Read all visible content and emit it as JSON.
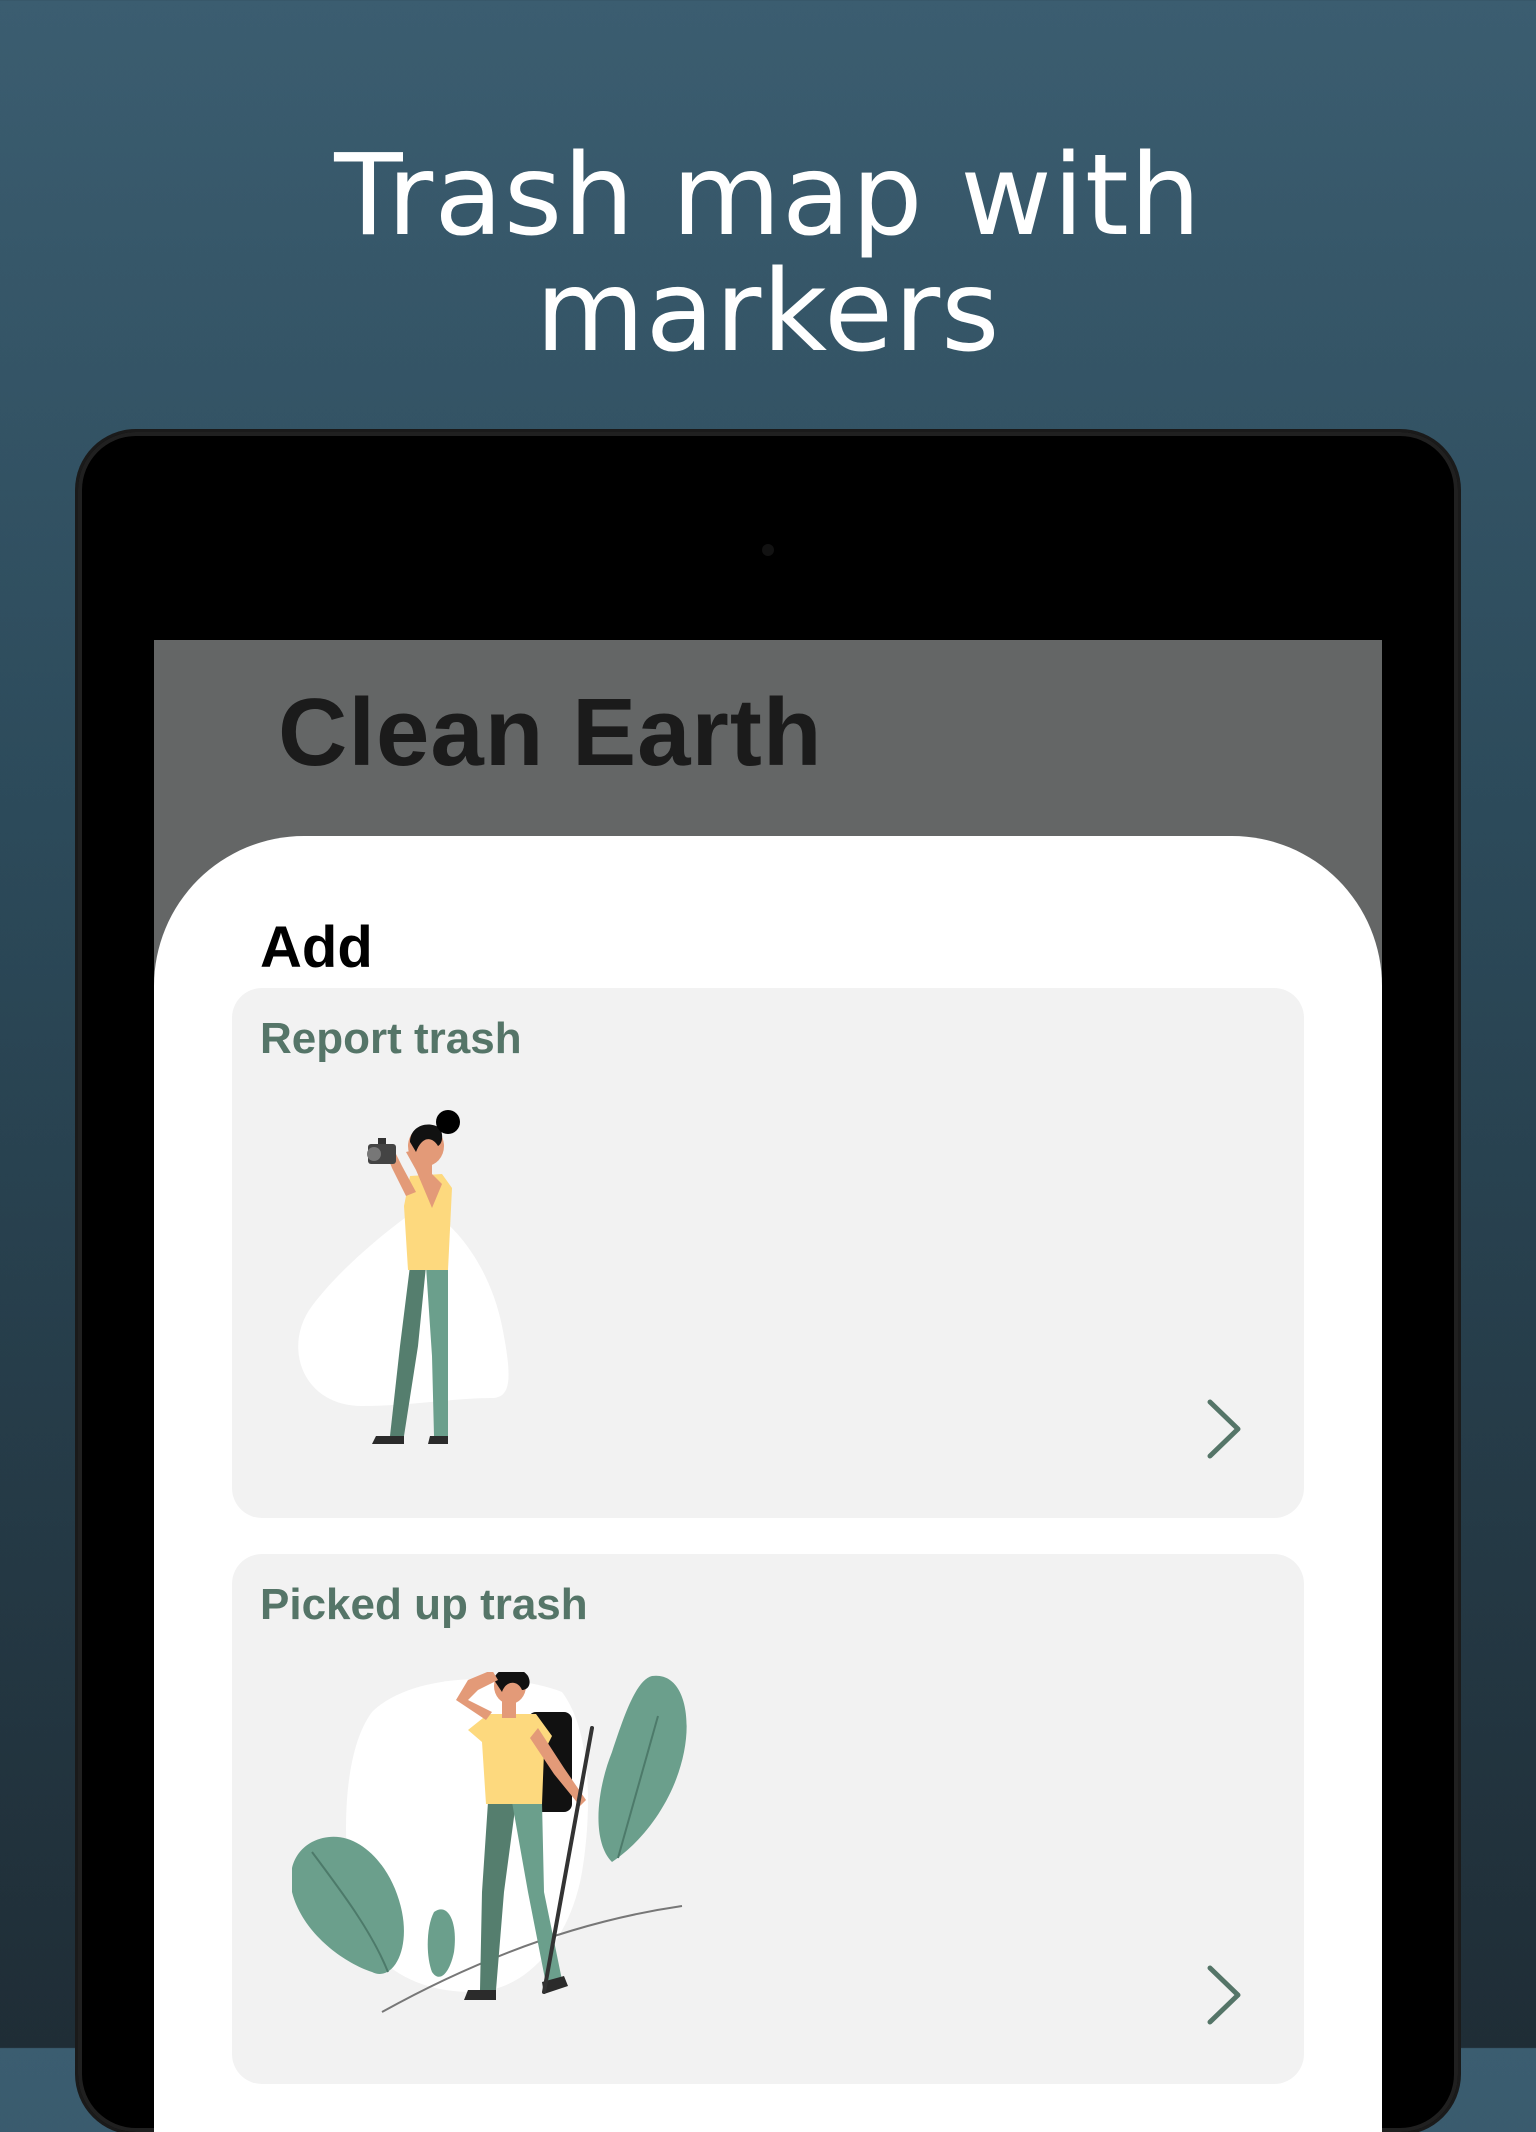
{
  "promo": {
    "headline_line1": "Trash map with",
    "headline_line2": "markers"
  },
  "app": {
    "title": "Clean Earth"
  },
  "add_section": {
    "title": "Add",
    "cards": [
      {
        "label": "Report trash",
        "illustration": "person-photographing-illustration",
        "action_icon": "chevron-right-icon"
      },
      {
        "label": "Picked up trash",
        "illustration": "person-with-trash-picker-illustration",
        "action_icon": "chevron-right-icon"
      }
    ]
  },
  "colors": {
    "background_top": "#3b5d70",
    "background_bottom": "#1f2d36",
    "app_bar": "#646666",
    "card_background": "#f2f2f2",
    "card_label": "#557568",
    "plant_green": "#6b9f8c",
    "shirt_yellow": "#fdd97e",
    "skin": "#e39a78"
  }
}
